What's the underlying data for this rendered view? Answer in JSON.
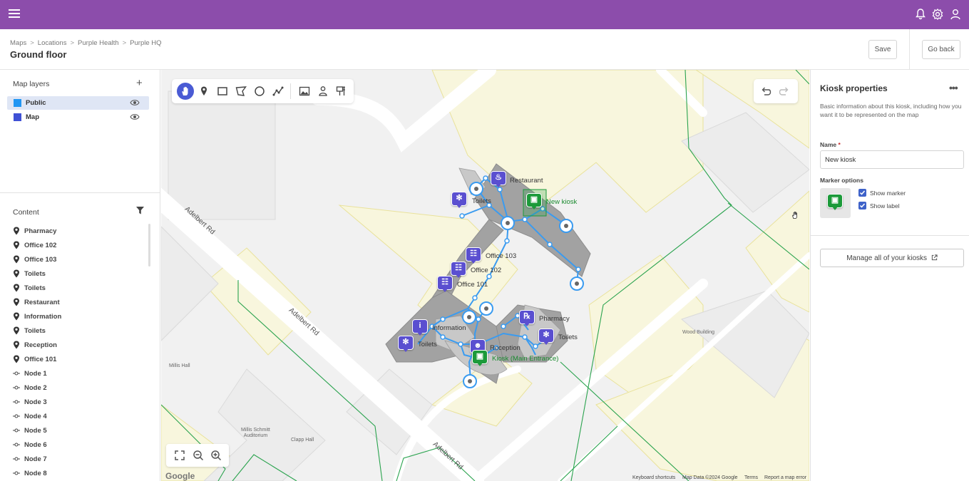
{
  "topbar": {
    "menu_icon": "hamburger-icon",
    "icons": [
      "bell-icon",
      "gear-icon",
      "user-icon"
    ],
    "color": "#8c4dab"
  },
  "header": {
    "breadcrumb": [
      "Maps",
      "Locations",
      "Purple Health",
      "Purple HQ"
    ],
    "title": "Ground floor",
    "save_label": "Save",
    "go_back_label": "Go back"
  },
  "layers": {
    "title": "Map layers",
    "add_icon": "plus-icon",
    "items": [
      {
        "label": "Public",
        "color": "#2196f3",
        "active": true
      },
      {
        "label": "Map",
        "color": "#3f51d5",
        "active": false
      }
    ]
  },
  "content": {
    "title": "Content",
    "filter_icon": "filter-icon",
    "items": [
      {
        "label": "Pharmacy",
        "icon": "pin-icon"
      },
      {
        "label": "Office 102",
        "icon": "pin-icon"
      },
      {
        "label": "Office 103",
        "icon": "pin-icon"
      },
      {
        "label": "Toilets",
        "icon": "pin-icon"
      },
      {
        "label": "Toilets",
        "icon": "pin-icon"
      },
      {
        "label": "Restaurant",
        "icon": "pin-icon"
      },
      {
        "label": "Information",
        "icon": "pin-icon"
      },
      {
        "label": "Toilets",
        "icon": "pin-icon"
      },
      {
        "label": "Reception",
        "icon": "pin-icon"
      },
      {
        "label": "Office 101",
        "icon": "pin-icon"
      },
      {
        "label": "Node 1",
        "icon": "node-icon"
      },
      {
        "label": "Node 2",
        "icon": "node-icon"
      },
      {
        "label": "Node 3",
        "icon": "node-icon"
      },
      {
        "label": "Node 4",
        "icon": "node-icon"
      },
      {
        "label": "Node 5",
        "icon": "node-icon"
      },
      {
        "label": "Node 6",
        "icon": "node-icon"
      },
      {
        "label": "Node 7",
        "icon": "node-icon"
      },
      {
        "label": "Node 8",
        "icon": "node-icon"
      }
    ]
  },
  "map": {
    "tools": [
      "hand-icon",
      "pin-icon",
      "rectangle-icon",
      "polygon-icon",
      "circle-icon",
      "polyline-icon",
      "image-icon",
      "person-pin-icon",
      "kiosk-icon"
    ],
    "active_tool": "hand-icon",
    "undo_icon": "undo-icon",
    "redo_icon": "redo-icon",
    "zoom_icons": [
      "fullscreen-icon",
      "zoom-out-icon",
      "zoom-in-icon"
    ],
    "labels": {
      "restaurant": "Restaurant",
      "new_kiosk": "New kiosk",
      "toilets1": "Toilets",
      "office103": "Office 103",
      "office102": "Office 102",
      "office101": "Office 101",
      "pharmacy": "Pharmacy",
      "information": "Information",
      "toilets2": "Toilets",
      "toilets3": "Toilets",
      "reception": "Reception",
      "main_kiosk": "Kiosk (Main Entrance)"
    },
    "streets": [
      "Adelbert Rd",
      "Adelbert Rd",
      "Adelbert Rd"
    ],
    "buildings": [
      "Millis Hall",
      "Millis Schmitt\nAuditorium",
      "Clapp Hall",
      "Wood Building"
    ],
    "google": "Google",
    "attribution": [
      "Keyboard shortcuts",
      "Map Data ©2024 Google",
      "Terms",
      "Report a map error"
    ],
    "accent": "#3a9bf0",
    "marker_color": "#5a4fd0",
    "kiosk_color": "#1c9a3a"
  },
  "kiosk": {
    "title": "Kiosk properties",
    "more_icon": "more-horizontal-icon",
    "description": "Basic information about this kiosk, including how you want it to be represented on the map",
    "name_label": "Name",
    "name_required": "*",
    "name_value": "New kiosk",
    "marker_options_label": "Marker options",
    "show_marker_label": "Show marker",
    "show_label_label": "Show label",
    "show_marker": true,
    "show_label": true,
    "manage_label": "Manage all of your kiosks",
    "external_icon": "external-link-icon"
  }
}
